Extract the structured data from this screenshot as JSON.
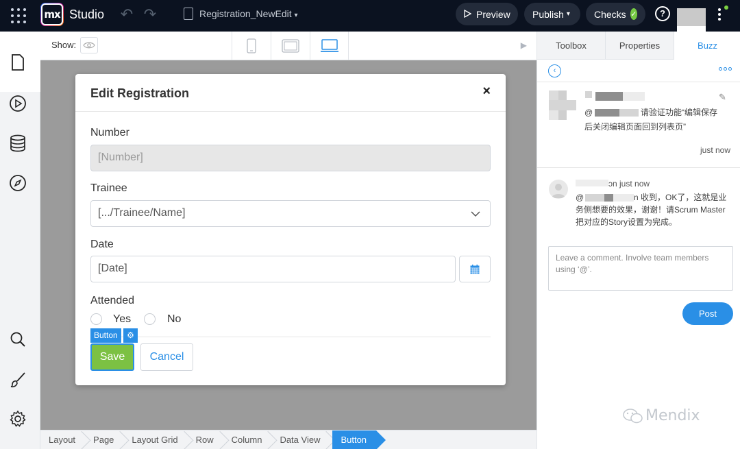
{
  "app": {
    "title": "Studio",
    "logo": "mx"
  },
  "topbar": {
    "document_name": "Registration_NewEdit",
    "preview_label": "Preview",
    "publish_label": "Publish",
    "checks_label": "Checks"
  },
  "toolbar": {
    "show_label": "Show:"
  },
  "dialog": {
    "title": "Edit Registration",
    "close_glyph": "×",
    "number_label": "Number",
    "number_value": "[Number]",
    "trainee_label": "Trainee",
    "trainee_value": "[.../Trainee/Name]",
    "date_label": "Date",
    "date_value": "[Date]",
    "attended_label": "Attended",
    "yes_label": "Yes",
    "no_label": "No",
    "button_tag": "Button",
    "save_label": "Save",
    "cancel_label": "Cancel"
  },
  "breadcrumb": [
    "Layout",
    "Page",
    "Layout Grid",
    "Row",
    "Column",
    "Data View",
    "Button"
  ],
  "right_panel": {
    "tabs": {
      "toolbox": "Toolbox",
      "properties": "Properties",
      "buzz": "Buzz"
    },
    "post1": {
      "mention_prefix": "@",
      "text_line1": "请验证功能“编辑保存",
      "text_line2": "后关闭编辑页面回到列表页”",
      "time": "just now"
    },
    "post2": {
      "author_suffix": "ɔn just now",
      "mention_prefix": "@",
      "text_line1": "n 收到，OK了，这就是业",
      "text_line2": "务侧想要的效果，谢谢！请Scrum Master",
      "text_line3": "把对应的Story设置为完成。"
    },
    "comment_placeholder": "Leave a comment. Involve team members using ‘@’.",
    "post_label": "Post",
    "watermark": "Mendix"
  },
  "colors": {
    "accent": "#2a8fe6",
    "save_green": "#7cc143",
    "topbar_bg": "#0b1220",
    "check_green": "#76ca44"
  }
}
